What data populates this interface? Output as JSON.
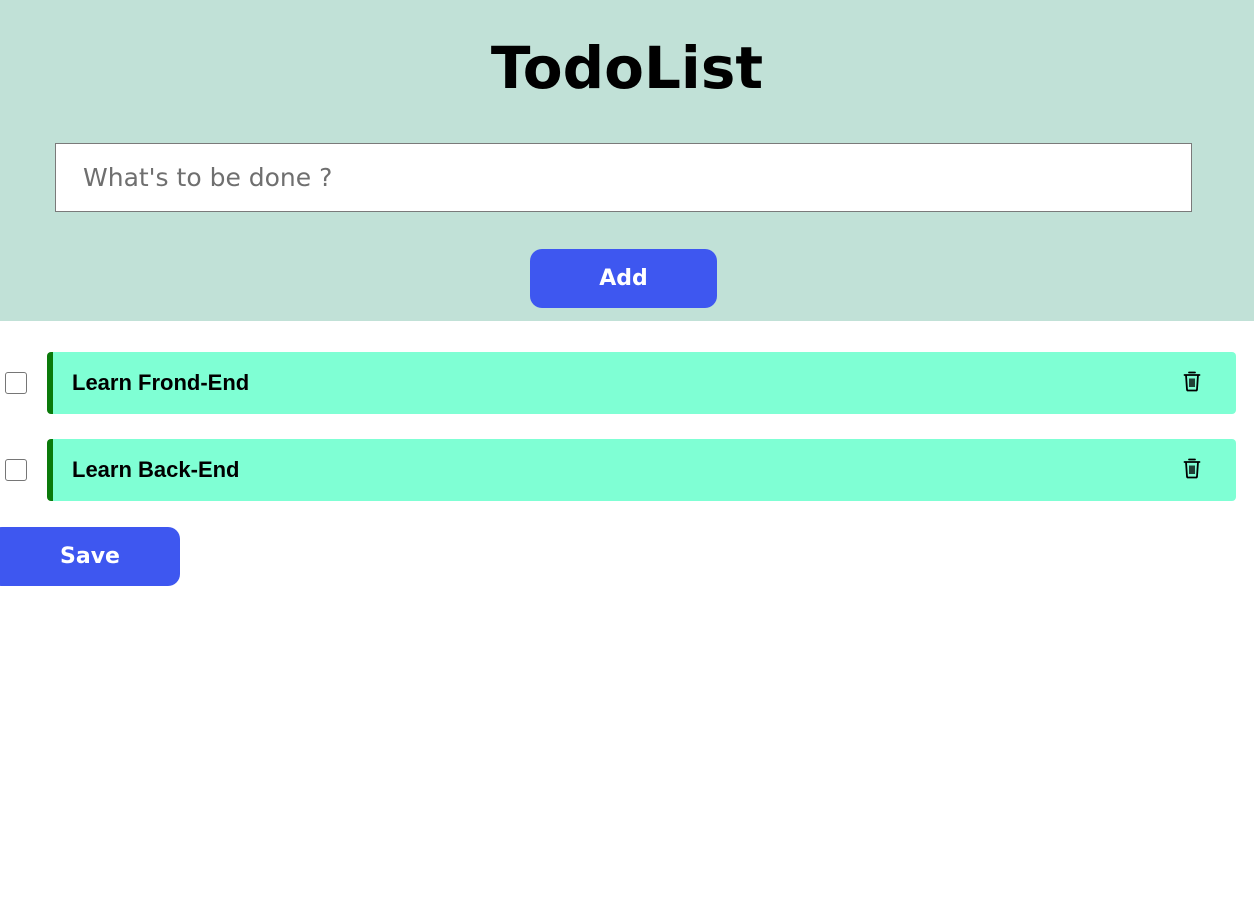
{
  "header": {
    "title": "TodoList",
    "input_placeholder": "What's to be done ?",
    "input_value": "",
    "add_label": "Add"
  },
  "todos": [
    {
      "text": "Learn Frond-End",
      "checked": false,
      "delete_icon": "trash-icon"
    },
    {
      "text": "Learn Back-End",
      "checked": false,
      "delete_icon": "trash-icon"
    }
  ],
  "footer": {
    "save_label": "Save"
  },
  "colors": {
    "header_bg": "#c1e1d7",
    "button_bg": "#3e57f0",
    "todo_bg": "#7fffd4",
    "todo_accent": "#0a7a0a"
  }
}
